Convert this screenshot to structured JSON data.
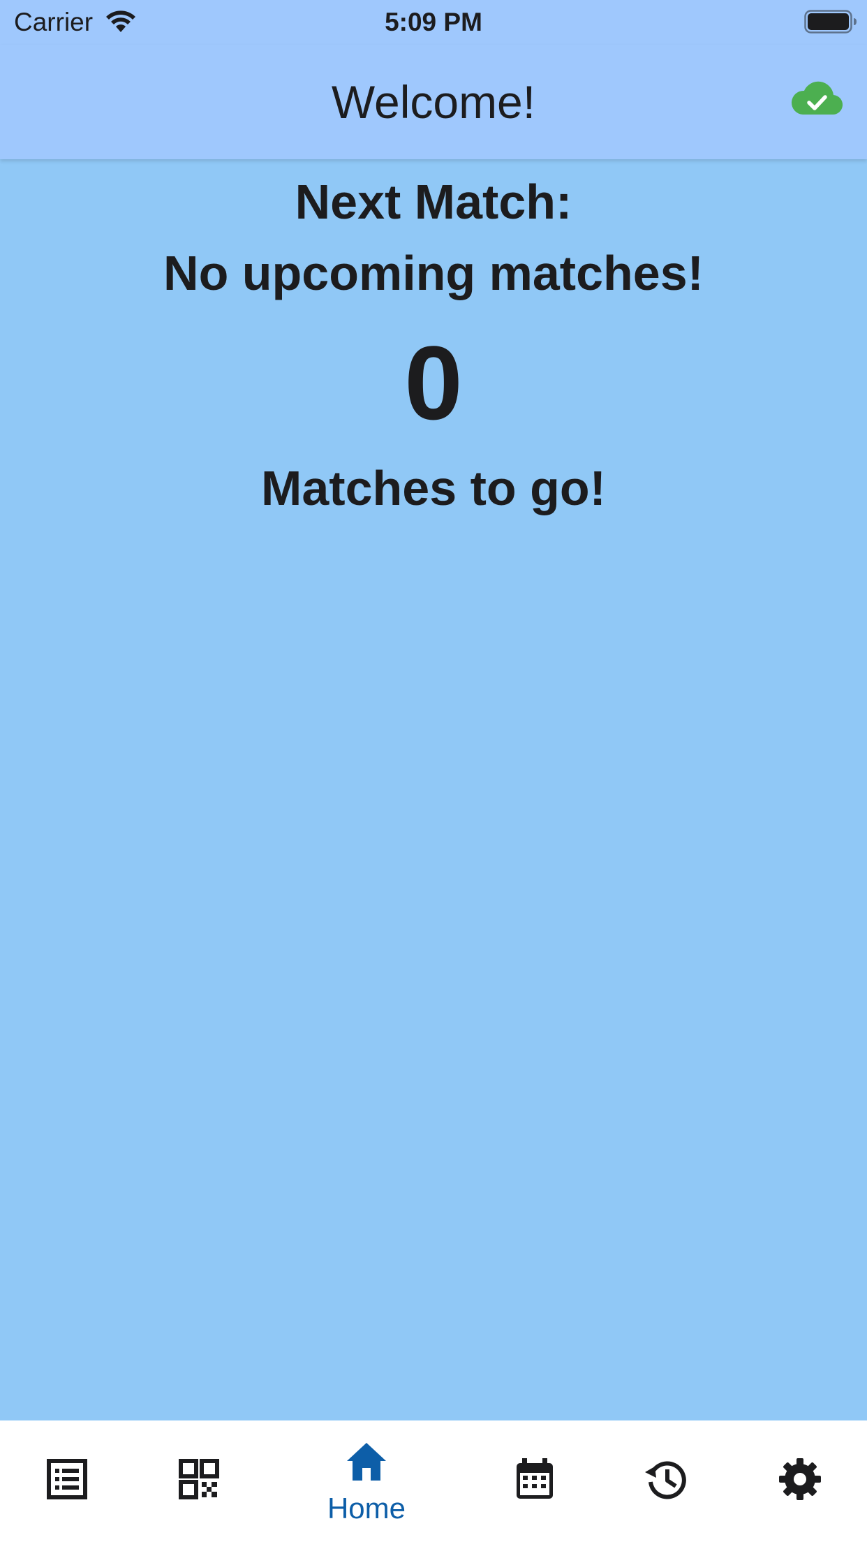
{
  "status_bar": {
    "carrier": "Carrier",
    "time": "5:09 PM",
    "icons": [
      "wifi-icon",
      "battery-icon"
    ]
  },
  "app_bar": {
    "title": "Welcome!",
    "sync_icon": "cloud-check-icon",
    "sync_color": "#4caf50"
  },
  "main": {
    "next_match_label": "Next Match:",
    "next_match_value": "No upcoming matches!",
    "matches_count": "0",
    "matches_label": "Matches to go!"
  },
  "bottom_nav": {
    "items": [
      {
        "icon": "list-icon",
        "label": ""
      },
      {
        "icon": "qr-code-icon",
        "label": ""
      },
      {
        "icon": "home-icon",
        "label": "Home",
        "active": true
      },
      {
        "icon": "calendar-icon",
        "label": ""
      },
      {
        "icon": "history-icon",
        "label": ""
      },
      {
        "icon": "settings-gear-icon",
        "label": ""
      }
    ],
    "active_color": "#0d5ea8"
  },
  "colors": {
    "background": "#90c8f6",
    "app_bar": "#9fc8fd",
    "nav_background": "#ffffff",
    "text": "#1c1c1e"
  }
}
